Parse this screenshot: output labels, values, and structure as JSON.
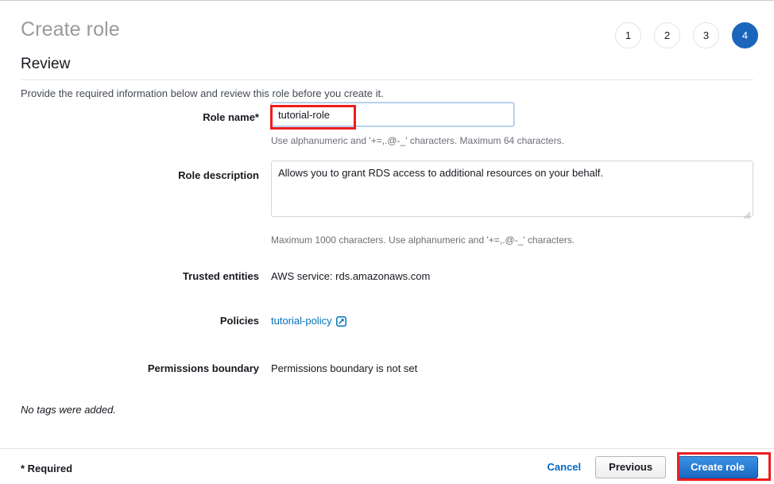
{
  "header": {
    "title": "Create role",
    "subtitle": "Review",
    "lede": "Provide the required information below and review this role before you create it.",
    "steps": [
      {
        "label": "1",
        "active": false
      },
      {
        "label": "2",
        "active": false
      },
      {
        "label": "3",
        "active": false
      },
      {
        "label": "4",
        "active": true
      }
    ]
  },
  "form": {
    "role_name": {
      "label": "Role name*",
      "value": "tutorial-role",
      "placeholder": "",
      "hint": "Use alphanumeric and '+=,.@-_' characters. Maximum 64 characters."
    },
    "role_description": {
      "label": "Role description",
      "value": "Allows you to grant RDS access to additional resources on your behalf.",
      "placeholder": "",
      "hint": "Maximum 1000 characters. Use alphanumeric and '+=,.@-_' characters.",
      "resize_grip_icon": "resize-grip-icon"
    },
    "trusted_entities": {
      "label": "Trusted entities",
      "value": "AWS service: rds.amazonaws.com"
    },
    "policies": {
      "label": "Policies",
      "link_text": "tutorial-policy",
      "link_icon": "external-link-icon"
    },
    "permissions_boundary": {
      "label": "Permissions boundary",
      "value": "Permissions boundary is not set"
    },
    "tags_note": "No tags were added."
  },
  "footer": {
    "required_note": "* Required",
    "cancel_label": "Cancel",
    "previous_label": "Previous",
    "create_label": "Create role"
  },
  "colors": {
    "accent_blue": "#1b66bc",
    "link_blue": "#0073bb",
    "annotation_red": "#ee1d1d",
    "primary_button_blue": "#1a69c4",
    "title_gray": "#9a9a9a"
  }
}
